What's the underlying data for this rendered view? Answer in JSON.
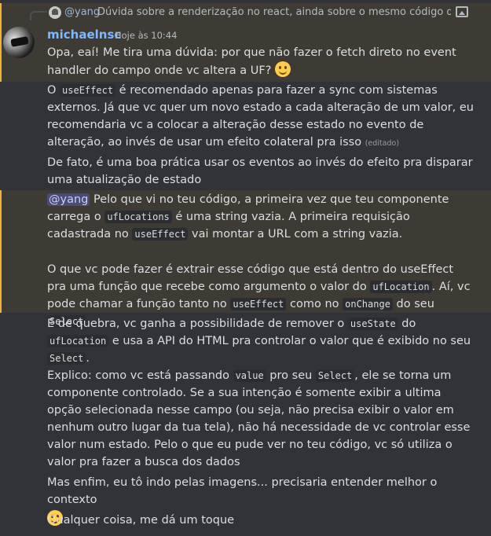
{
  "reply": {
    "mention": "@yang",
    "text": "Dúvida sobre a renderização no react, ainda sobre o mesmo código de antes",
    "icon": "image-icon"
  },
  "header": {
    "username": "michaelnsc",
    "timestamp": "Hoje às 10:44"
  },
  "colors": {
    "highlight_bg": "#3e3b34",
    "mention_bar": "#f0b232",
    "username": "#7eb8ff",
    "background": "#323339"
  },
  "messages": {
    "m1": "Opa, eaí! Me tira uma dúvida: por que não fazer o fetch direto no event handler do campo onde vc altera a UF?",
    "m2_a": "O ",
    "m2_code": "useEffect",
    "m2_b": " é recomendado apenas para fazer a sync com sistemas externos. Já que vc quer um novo estado a cada alteração de um valor, eu recomendaria vc a colocar a alteração desse estado no evento de alteração, ao invés de usar um efeito colateral pra isso",
    "m2_edited": "(editado)",
    "m3": "De fato, é uma boa prática usar os eventos ao invés do efeito pra disparar uma atualização de estado",
    "m4_mention": "@yang",
    "m4_a": " Pelo que vi no teu código, a primeira vez que teu componente carrega o ",
    "m4_code1": "ufLocations",
    "m4_b": " é uma string vazia. A primeira requisição cadastrada no ",
    "m4_code2": "useEffect",
    "m4_c": " vai montar a URL com a string vazia.",
    "m4_d": "O que vc pode fazer é extrair esse código que está dentro do useEffect pra uma função que recebe como argumento o valor do ",
    "m4_code3": "ufLocation",
    "m4_e": ". Aí, vc pode chamar a função tanto no ",
    "m4_code4": "useEffect",
    "m4_f": " como no ",
    "m4_code5": "onChange",
    "m4_g": " do seu ",
    "m4_code6": "Select",
    "m5_a": "E de quebra, vc ganha a possibilidade de remover o ",
    "m5_code1": "useState",
    "m5_b": " do ",
    "m5_code2": "ufLocation",
    "m5_c": " e usa a API do HTML pra controlar o valor que é exibido no seu ",
    "m5_code3": "Select",
    "m5_d": ".",
    "m5_e": "Explico: como vc está passando ",
    "m5_code4": "value",
    "m5_f": " pro seu ",
    "m5_code5": "Select",
    "m5_g": ", ele se torna um componente controlado. Se a sua intenção é somente exibir a ultima opção selecionada nesse campo (ou seja, não precisa exibir o valor em nenhum outro lugar da tua tela), não há necessidade de vc controlar esse valor num estado. Pelo o que eu pude ver no teu código, vc só utiliza o valor pra fazer a busca dos dados",
    "m6": "Mas enfim, eu tô indo pelas imagens... precisaria entender melhor o contexto",
    "m7": "Qualquer coisa, me dá um toque"
  }
}
